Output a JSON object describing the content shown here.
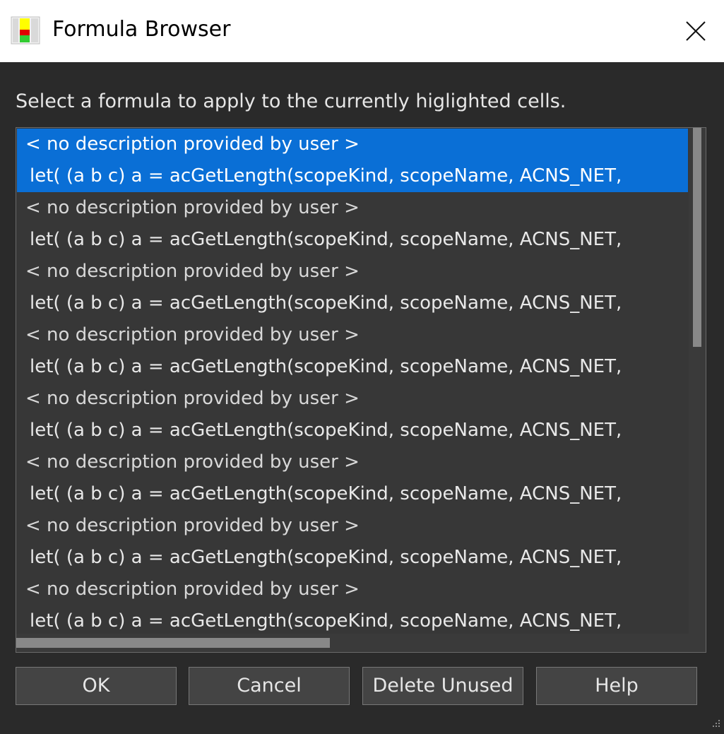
{
  "window": {
    "title": "Formula Browser",
    "icon": "spreadsheet-icon",
    "close_icon": "close-icon"
  },
  "prompt": "Select a formula to apply to the currently higlighted  cells.",
  "list": {
    "selected_index": 0,
    "items": [
      {
        "description": "< no description provided by user >",
        "formula": "let( (a b c) a = acGetLength(scopeKind, scopeName, ACNS_NET,"
      },
      {
        "description": "< no description provided by user >",
        "formula": "let( (a b c) a = acGetLength(scopeKind, scopeName, ACNS_NET,"
      },
      {
        "description": "< no description provided by user >",
        "formula": "let( (a b c) a = acGetLength(scopeKind, scopeName, ACNS_NET,"
      },
      {
        "description": "< no description provided by user >",
        "formula": "let( (a b c) a = acGetLength(scopeKind, scopeName, ACNS_NET,"
      },
      {
        "description": "< no description provided by user >",
        "formula": "let( (a b c) a = acGetLength(scopeKind, scopeName, ACNS_NET,"
      },
      {
        "description": "< no description provided by user >",
        "formula": "let( (a b c) a = acGetLength(scopeKind, scopeName, ACNS_NET,"
      },
      {
        "description": "< no description provided by user >",
        "formula": "let( (a b c) a = acGetLength(scopeKind, scopeName, ACNS_NET,"
      },
      {
        "description": "< no description provided by user >",
        "formula": "let( (a b c) a = acGetLength(scopeKind, scopeName, ACNS_NET,"
      }
    ]
  },
  "buttons": {
    "ok": "OK",
    "cancel": "Cancel",
    "delete_unused": "Delete Unused",
    "help": "Help"
  },
  "colors": {
    "selection": "#0a6fd6",
    "background": "#2a2a2a"
  }
}
